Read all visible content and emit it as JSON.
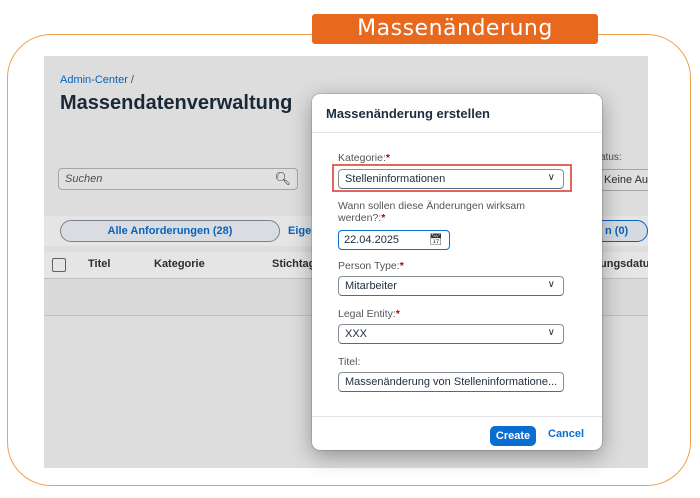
{
  "banner": "Massenänderung",
  "page": {
    "breadcrumb": "Admin-Center",
    "breadcrumb_sep": "/",
    "title": "Massendatenverwaltung",
    "search_placeholder": "Suchen",
    "status_label": "atus:",
    "status_value": "Keine Aus"
  },
  "tabs": {
    "all": "Alle Anforderungen (28)",
    "own": "Eige",
    "last": "n (0)"
  },
  "table": {
    "columns": [
      "Titel",
      "Kategorie",
      "Stichtag",
      "ungsdatum"
    ]
  },
  "dialog": {
    "title": "Massenänderung erstellen",
    "category_label": "Kategorie:",
    "category_value": "Stelleninformationen",
    "effective_label": "Wann sollen diese Änderungen wirksam werden?:",
    "effective_value": "22.04.2025",
    "person_type_label": "Person Type:",
    "person_type_value": "Mitarbeiter",
    "legal_entity_label": "Legal Entity:",
    "legal_entity_value": "XXX",
    "title_label": "Titel:",
    "title_value": "Massenänderung von Stelleninformatione...",
    "required_mark": "*",
    "create_label": "Create",
    "cancel_label": "Cancel"
  },
  "colors": {
    "accent": "#0a6ed1",
    "banner": "#e8681d",
    "frame": "#f0a04e",
    "highlight": "#e0675e",
    "required": "#bb0000"
  }
}
